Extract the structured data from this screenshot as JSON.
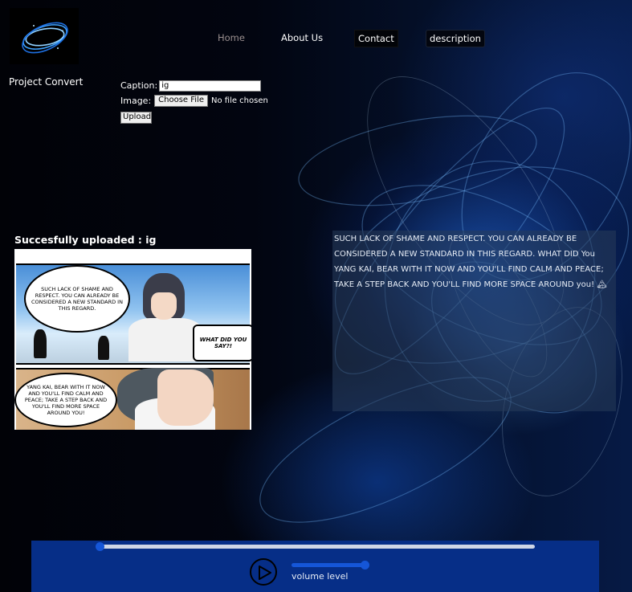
{
  "header": {
    "site_name": "Project Convert",
    "logo_icon": "blue-swirl-ring-logo"
  },
  "nav": {
    "items": [
      {
        "label": "Home",
        "state": "active",
        "color": "#9a8f8f"
      },
      {
        "label": "About Us"
      },
      {
        "label": "Contact"
      },
      {
        "label": "description"
      }
    ]
  },
  "upload_form": {
    "caption_label": "Caption:",
    "caption_value": "ig",
    "image_label": "Image:",
    "file_button_label": "Choose File",
    "file_status": "No file chosen",
    "upload_button_label": "Upload"
  },
  "result": {
    "success_message": "Succesfully uploaded : ig",
    "comic": {
      "bubble_1": "SUCH LACK OF SHAME AND RESPECT. YOU CAN ALREADY BE CONSIDERED A NEW STANDARD IN THIS REGARD.",
      "bubble_2": "WHAT DID YOU SAY?!",
      "bubble_3": "YANG KAI, BEAR WITH IT NOW AND YOU'LL FIND CALM AND PEACE; TAKE A STEP BACK AND YOU'LL FIND MORE SPACE AROUND YOU!"
    }
  },
  "description_text": "SUCH LACK OF SHAME AND RESPECT. YOU CAN ALREADY BE CONSIDERED A NEW STANDARD IN THIS REGARD. WHAT DID You YANG KAI, BEAR WITH IT NOW AND YOU'LL FIND CALM AND PEACE; TAKE A STEP BACK AND YOU'LL FIND MORE SPACE AROUND you! 🏔",
  "player": {
    "seek_progress": 0.0,
    "volume_level": 1.0,
    "volume_label": "volume level",
    "play_icon": "play-icon",
    "accent_color": "#1556d8",
    "bar_color": "#062e87"
  }
}
